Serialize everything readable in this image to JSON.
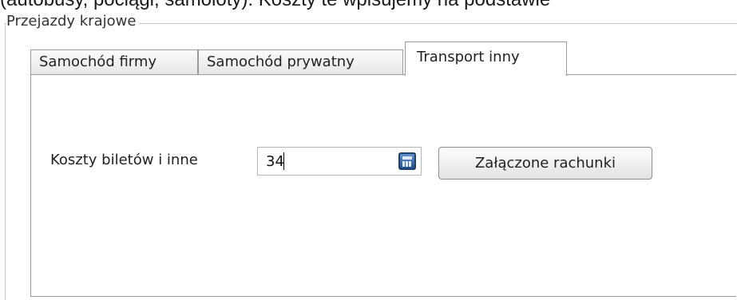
{
  "page": {
    "top_text": "(autobusy, pociągi, samoloty). Koszty te wpisujemy na podstawie"
  },
  "fieldset": {
    "legend": "Przejazdy krajowe"
  },
  "tabs": [
    {
      "label": "Samochód firmy",
      "active": false
    },
    {
      "label": "Samochód prywatny",
      "active": false
    },
    {
      "label": "Transport inny",
      "active": true
    }
  ],
  "form": {
    "cost_label": "Koszty biletów i inne",
    "cost_value": "34",
    "calculator_icon": "calculator-icon",
    "attachments_button": "Załączone rachunki"
  }
}
